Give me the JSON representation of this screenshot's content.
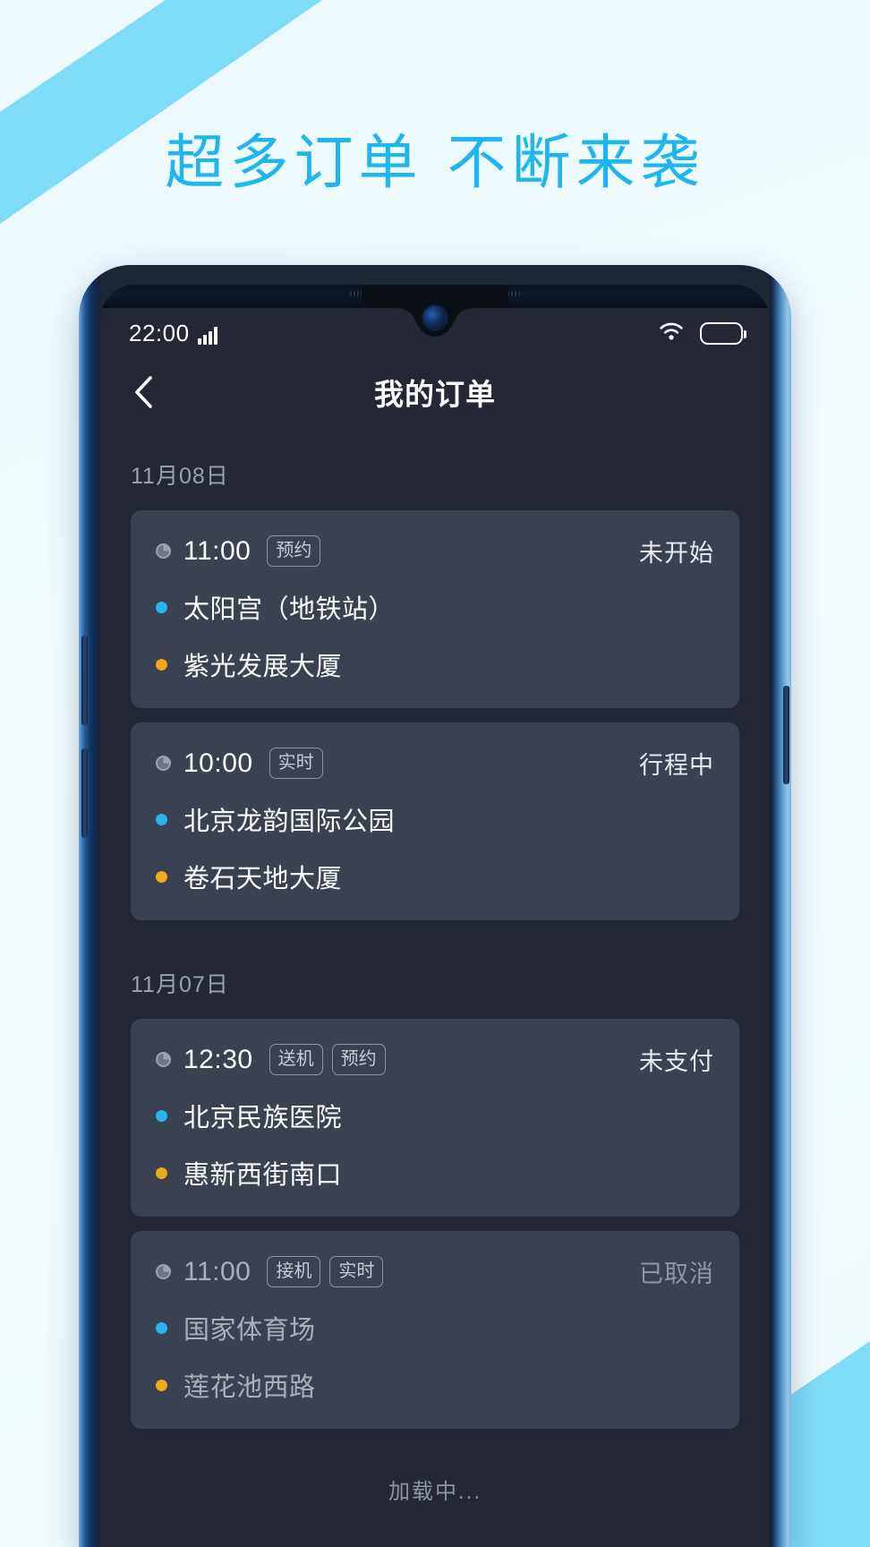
{
  "headline": "超多订单 不断来袭",
  "theme": {
    "accent_cyan": "#1fb6ef",
    "decor_cyan": "#7fdcf7",
    "page_bg": "#eefafd",
    "screen_bg": "#232834",
    "card_bg": "#3a4150",
    "start_dot": "#28b4f0",
    "end_dot": "#f0a81e"
  },
  "status_bar": {
    "time": "22:00",
    "signal_icon": "signal-bars-icon",
    "wifi_icon": "wifi-icon",
    "battery_icon": "battery-icon"
  },
  "titlebar": {
    "back_icon": "back-chevron-icon",
    "title": "我的订单"
  },
  "groups": [
    {
      "date": "11月08日",
      "orders": [
        {
          "clock_icon": "clock-icon",
          "time": "11:00",
          "tags": [
            "预约"
          ],
          "status": "未开始",
          "cancelled": false,
          "start": "太阳宫（地铁站）",
          "end": "紫光发展大厦"
        },
        {
          "clock_icon": "clock-icon",
          "time": "10:00",
          "tags": [
            "实时"
          ],
          "status": "行程中",
          "cancelled": false,
          "start": "北京龙韵国际公园",
          "end": "卷石天地大厦"
        }
      ]
    },
    {
      "date": "11月07日",
      "orders": [
        {
          "clock_icon": "clock-icon",
          "time": "12:30",
          "tags": [
            "送机",
            "预约"
          ],
          "status": "未支付",
          "cancelled": false,
          "start": "北京民族医院",
          "end": "惠新西街南口"
        },
        {
          "clock_icon": "clock-icon",
          "time": "11:00",
          "tags": [
            "接机",
            "实时"
          ],
          "status": "已取消",
          "cancelled": true,
          "start": "国家体育场",
          "end": "莲花池西路"
        }
      ]
    }
  ],
  "loading_text": "加载中..."
}
